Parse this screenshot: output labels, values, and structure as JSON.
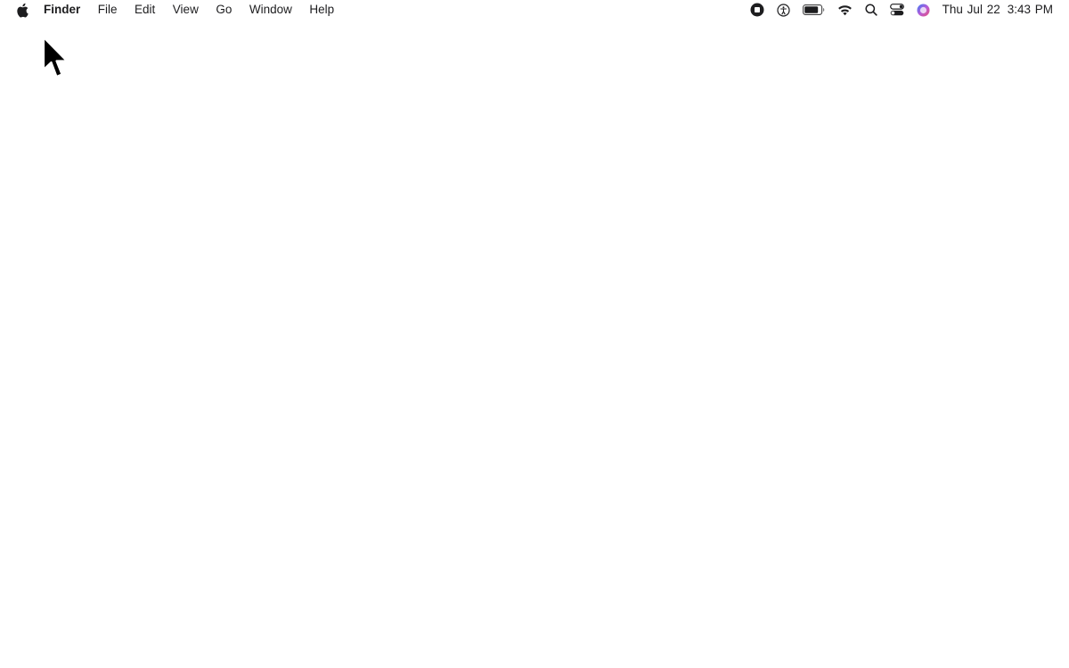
{
  "menubar": {
    "apple_icon": "apple-logo-icon",
    "app_name": "Finder",
    "menus": [
      "File",
      "Edit",
      "View",
      "Go",
      "Window",
      "Help"
    ],
    "status_icons": [
      "screen-recording-stop-icon",
      "accessibility-icon",
      "battery-icon",
      "wifi-icon",
      "spotlight-search-icon",
      "control-center-icon",
      "siri-icon"
    ],
    "date": "Thu Jul 22",
    "time": "3:43 PM"
  },
  "desktop": {
    "background_color": "#ffffff",
    "cursor": "arrow-cursor-icon"
  }
}
